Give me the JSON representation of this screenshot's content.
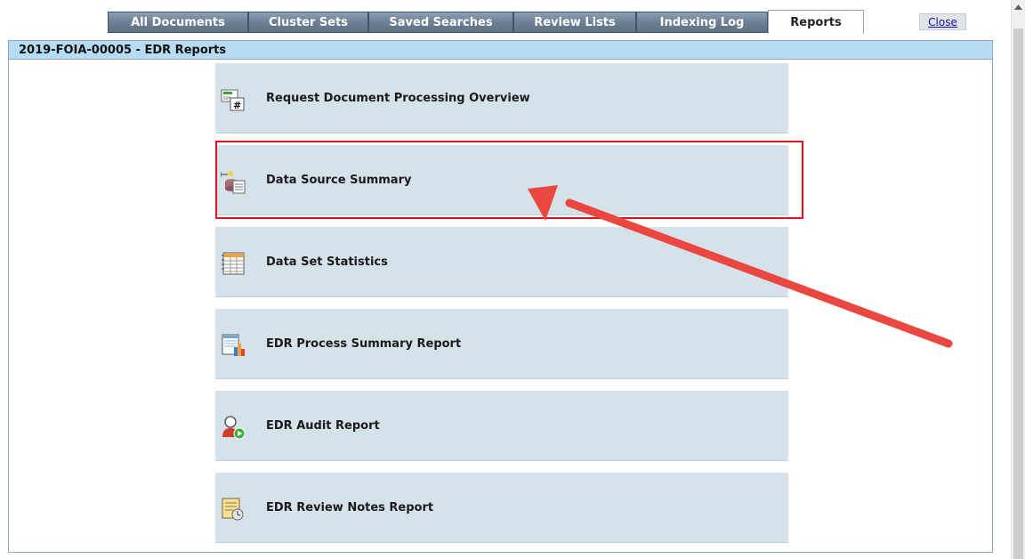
{
  "tabs": [
    {
      "label": "All Documents",
      "active": false
    },
    {
      "label": "Cluster Sets",
      "active": false
    },
    {
      "label": "Saved Searches",
      "active": false
    },
    {
      "label": "Review Lists",
      "active": false
    },
    {
      "label": "Indexing Log",
      "active": false
    },
    {
      "label": "Reports",
      "active": true
    }
  ],
  "close_label": "Close",
  "panel": {
    "title": "2019-FOIA-00005 - EDR Reports"
  },
  "reports": [
    {
      "label": "Request Document Processing Overview",
      "icon": "progress-counter-icon"
    },
    {
      "label": "Data Source Summary",
      "icon": "data-source-icon"
    },
    {
      "label": "Data Set Statistics",
      "icon": "spreadsheet-icon"
    },
    {
      "label": "EDR Process Summary Report",
      "icon": "report-chart-icon"
    },
    {
      "label": "EDR Audit Report",
      "icon": "user-audit-icon"
    },
    {
      "label": "EDR Review Notes Report",
      "icon": "notes-clock-icon"
    }
  ],
  "annotation": {
    "highlighted_item": "Data Source Summary",
    "color": "#e0121c",
    "arrow_color": "#e9473f"
  },
  "colors": {
    "tab_gradient_top": "#8da0b2",
    "tab_gradient_bottom": "#5b7084",
    "panel_header": "#b6dcf3",
    "card_background": "#d6e2e9"
  }
}
